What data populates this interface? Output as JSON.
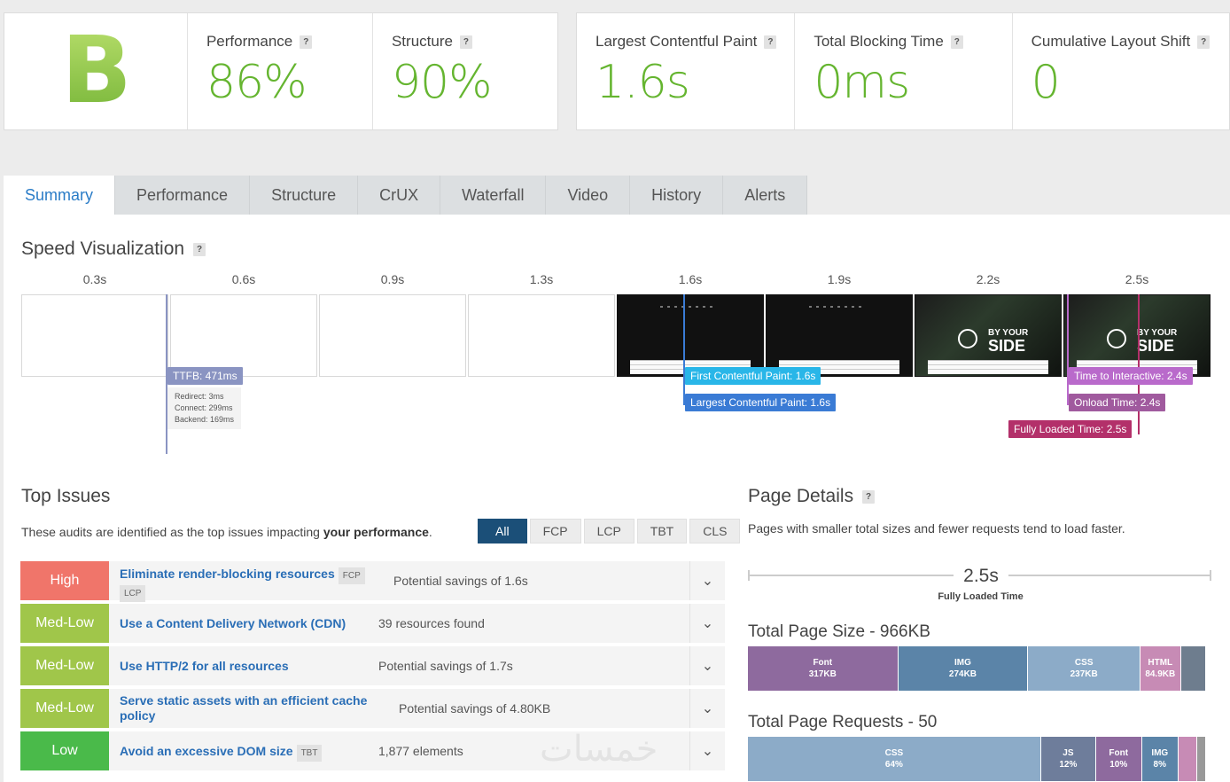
{
  "grade": "B",
  "scores": {
    "performance": {
      "label": "Performance",
      "value": "86%"
    },
    "structure": {
      "label": "Structure",
      "value": "90%"
    }
  },
  "vitals": {
    "lcp": {
      "label": "Largest Contentful Paint",
      "value": "1.6s"
    },
    "tbt": {
      "label": "Total Blocking Time",
      "value": "0ms"
    },
    "cls": {
      "label": "Cumulative Layout Shift",
      "value": "0"
    }
  },
  "help_glyph": "?",
  "tabs": [
    "Summary",
    "Performance",
    "Structure",
    "CrUX",
    "Waterfall",
    "Video",
    "History",
    "Alerts"
  ],
  "speed_viz": {
    "title": "Speed Visualization",
    "times": [
      "0.3s",
      "0.6s",
      "0.9s",
      "1.3s",
      "1.6s",
      "1.9s",
      "2.2s",
      "2.5s"
    ],
    "hero": {
      "line1": "BY YOUR",
      "line2": "SIDE"
    },
    "markers": {
      "ttfb": "TTFB: 471ms",
      "ttfb_redirect": "Redirect: 3ms",
      "ttfb_connect": "Connect: 299ms",
      "ttfb_backend": "Backend: 169ms",
      "fcp": "First Contentful Paint: 1.6s",
      "lcp": "Largest Contentful Paint: 1.6s",
      "tti": "Time to Interactive: 2.4s",
      "onload": "Onload Time: 2.4s",
      "fully_loaded": "Fully Loaded Time: 2.5s"
    },
    "colors": {
      "ttfb": "#8a94c2",
      "fcp": "#29b6e8",
      "lcp": "#3a7bd5",
      "tti": "#b96acb",
      "onload": "#a05a9e",
      "fully_loaded": "#b3306a"
    }
  },
  "top_issues": {
    "title": "Top Issues",
    "desc_prefix": "These audits are identified as the top issues impacting ",
    "desc_bold": "your performance",
    "desc_suffix": ".",
    "filters": [
      "All",
      "FCP",
      "LCP",
      "TBT",
      "CLS"
    ],
    "items": [
      {
        "severity": "High",
        "name": "Eliminate render-blocking resources",
        "tags": [
          "FCP",
          "LCP"
        ],
        "detail": "Potential savings of 1.6s"
      },
      {
        "severity": "Med-Low",
        "name": "Use a Content Delivery Network (CDN)",
        "tags": [],
        "detail": "39 resources found"
      },
      {
        "severity": "Med-Low",
        "name": "Use HTTP/2 for all resources",
        "tags": [],
        "detail": "Potential savings of 1.7s"
      },
      {
        "severity": "Med-Low",
        "name": "Serve static assets with an efficient cache policy",
        "tags": [],
        "detail": "Potential savings of 4.80KB"
      },
      {
        "severity": "Low",
        "name": "Avoid an excessive DOM size",
        "tags": [
          "TBT"
        ],
        "detail": "1,877 elements"
      }
    ],
    "chevron": "⌄"
  },
  "watermark": "خمسات",
  "page_details": {
    "title": "Page Details",
    "desc": "Pages with smaller total sizes and fewer requests tend to load faster.",
    "fully_loaded_value": "2.5s",
    "fully_loaded_label": "Fully Loaded Time",
    "size_title": "Total Page Size - 966KB",
    "size_segments": [
      {
        "name": "Font",
        "value": "317KB",
        "share": 0.328,
        "color": "#8e6a9e"
      },
      {
        "name": "IMG",
        "value": "274KB",
        "share": 0.284,
        "color": "#5b84a8"
      },
      {
        "name": "CSS",
        "value": "237KB",
        "share": 0.245,
        "color": "#8cabc8"
      },
      {
        "name": "HTML",
        "value": "84.9KB",
        "share": 0.088,
        "color": "#c78bb5"
      },
      {
        "name": "",
        "value": "",
        "share": 0.055,
        "color": "#6e7d8e"
      }
    ],
    "requests_title": "Total Page Requests - 50",
    "request_segments": [
      {
        "name": "CSS",
        "value": "64%",
        "share": 0.64,
        "color": "#8cabc8"
      },
      {
        "name": "JS",
        "value": "12%",
        "share": 0.12,
        "color": "#6e7d9b"
      },
      {
        "name": "Font",
        "value": "10%",
        "share": 0.1,
        "color": "#8e6a9e"
      },
      {
        "name": "IMG",
        "value": "8%",
        "share": 0.08,
        "color": "#5b84a8"
      },
      {
        "name": "",
        "value": "",
        "share": 0.04,
        "color": "#c78bb5"
      },
      {
        "name": "",
        "value": "",
        "share": 0.02,
        "color": "#999999"
      }
    ]
  }
}
